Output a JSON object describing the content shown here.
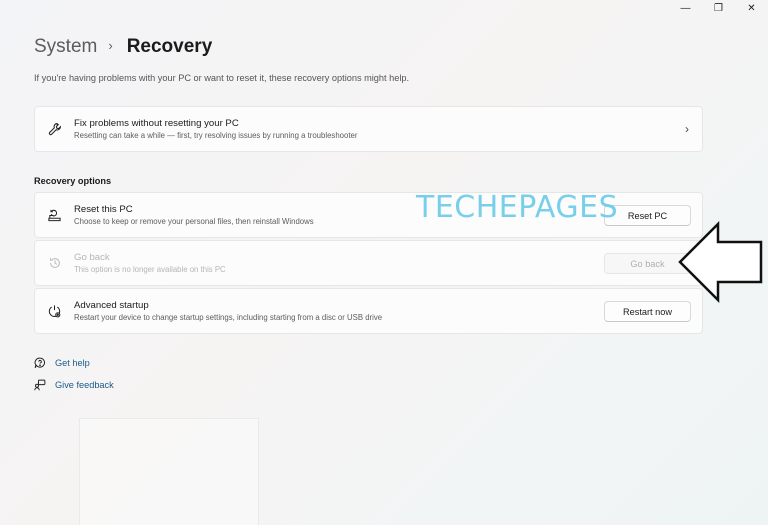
{
  "window": {
    "minimize_glyph": "—",
    "restore_glyph": "❐",
    "close_glyph": "✕"
  },
  "breadcrumb": {
    "parent": "System",
    "separator": "›",
    "current": "Recovery"
  },
  "subtitle": "If you're having problems with your PC or want to reset it, these recovery options might help.",
  "fix_card": {
    "icon": "wrench-icon",
    "title": "Fix problems without resetting your PC",
    "description": "Resetting can take a while — first, try resolving issues by running a troubleshooter",
    "chevron": "›"
  },
  "recovery_options": {
    "heading": "Recovery options",
    "items": [
      {
        "icon": "reset-pc-icon",
        "title": "Reset this PC",
        "description": "Choose to keep or remove your personal files, then reinstall Windows",
        "button": "Reset PC",
        "enabled": true
      },
      {
        "icon": "history-icon",
        "title": "Go back",
        "description": "This option is no longer available on this PC",
        "button": "Go back",
        "enabled": false
      },
      {
        "icon": "advanced-startup-icon",
        "title": "Advanced startup",
        "description": "Restart your device to change startup settings, including starting from a disc or USB drive",
        "button": "Restart now",
        "enabled": true
      }
    ]
  },
  "links": {
    "get_help": "Get help",
    "give_feedback": "Give feedback"
  },
  "watermark": "TECHEPAGES",
  "colors": {
    "accent_link": "#1a5b8a",
    "watermark": "#62c8e8",
    "disabled_text": "#b5b5b5"
  }
}
